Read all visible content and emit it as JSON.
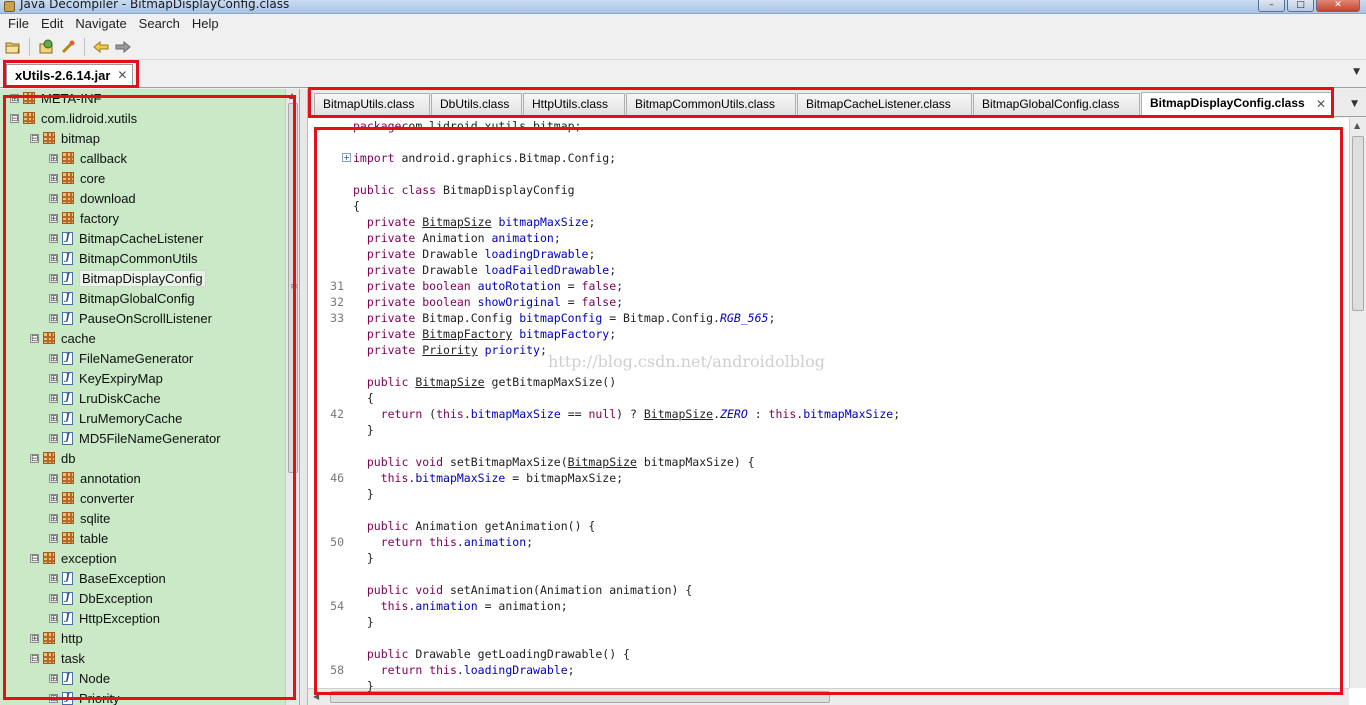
{
  "window": {
    "title": "Java Decompiler - BitmapDisplayConfig.class",
    "controls": [
      "–",
      "□",
      "✕"
    ]
  },
  "menu": [
    "File",
    "Edit",
    "Navigate",
    "Search",
    "Help"
  ],
  "toolbar": {
    "icons": [
      "open-folder-icon",
      "open-type-icon",
      "open-type-hierarchy-icon",
      "back-arrow-icon",
      "forward-arrow-icon"
    ]
  },
  "jar_tab": {
    "label": "xUtils-2.6.14.jar",
    "close": "✕"
  },
  "tree": {
    "expanded": "⊟",
    "collapsed": "⊞",
    "items": [
      {
        "label": "META-INF",
        "type": "package",
        "level": 0,
        "expander": "collapsed"
      },
      {
        "label": "com.lidroid.xutils",
        "type": "package",
        "level": 0,
        "expander": "expanded"
      },
      {
        "label": "bitmap",
        "type": "package",
        "level": 1,
        "expander": "expanded"
      },
      {
        "label": "callback",
        "type": "package",
        "level": 2,
        "expander": "collapsed"
      },
      {
        "label": "core",
        "type": "package",
        "level": 2,
        "expander": "collapsed"
      },
      {
        "label": "download",
        "type": "package",
        "level": 2,
        "expander": "collapsed"
      },
      {
        "label": "factory",
        "type": "package",
        "level": 2,
        "expander": "collapsed"
      },
      {
        "label": "BitmapCacheListener",
        "type": "class",
        "level": 2,
        "expander": "collapsed"
      },
      {
        "label": "BitmapCommonUtils",
        "type": "class",
        "level": 2,
        "expander": "collapsed"
      },
      {
        "label": "BitmapDisplayConfig",
        "type": "class",
        "level": 2,
        "expander": "collapsed",
        "selected": true
      },
      {
        "label": "BitmapGlobalConfig",
        "type": "class",
        "level": 2,
        "expander": "collapsed"
      },
      {
        "label": "PauseOnScrollListener",
        "type": "class",
        "level": 2,
        "expander": "collapsed"
      },
      {
        "label": "cache",
        "type": "package",
        "level": 1,
        "expander": "expanded"
      },
      {
        "label": "FileNameGenerator",
        "type": "class",
        "level": 2,
        "expander": "collapsed"
      },
      {
        "label": "KeyExpiryMap",
        "type": "class",
        "level": 2,
        "expander": "collapsed"
      },
      {
        "label": "LruDiskCache",
        "type": "class",
        "level": 2,
        "expander": "collapsed"
      },
      {
        "label": "LruMemoryCache",
        "type": "class",
        "level": 2,
        "expander": "collapsed"
      },
      {
        "label": "MD5FileNameGenerator",
        "type": "class",
        "level": 2,
        "expander": "collapsed"
      },
      {
        "label": "db",
        "type": "package",
        "level": 1,
        "expander": "expanded"
      },
      {
        "label": "annotation",
        "type": "package",
        "level": 2,
        "expander": "collapsed"
      },
      {
        "label": "converter",
        "type": "package",
        "level": 2,
        "expander": "collapsed"
      },
      {
        "label": "sqlite",
        "type": "package",
        "level": 2,
        "expander": "collapsed"
      },
      {
        "label": "table",
        "type": "package",
        "level": 2,
        "expander": "collapsed"
      },
      {
        "label": "exception",
        "type": "package",
        "level": 1,
        "expander": "expanded"
      },
      {
        "label": "BaseException",
        "type": "class",
        "level": 2,
        "expander": "collapsed"
      },
      {
        "label": "DbException",
        "type": "class",
        "level": 2,
        "expander": "collapsed"
      },
      {
        "label": "HttpException",
        "type": "class",
        "level": 2,
        "expander": "collapsed"
      },
      {
        "label": "http",
        "type": "package",
        "level": 1,
        "expander": "collapsed"
      },
      {
        "label": "task",
        "type": "package",
        "level": 1,
        "expander": "expanded"
      },
      {
        "label": "Node",
        "type": "class",
        "level": 2,
        "expander": "collapsed"
      },
      {
        "label": "Priority",
        "type": "class",
        "level": 2,
        "expander": "collapsed"
      }
    ]
  },
  "class_tabs": [
    {
      "label": "BitmapUtils.class"
    },
    {
      "label": "DbUtils.class"
    },
    {
      "label": "HttpUtils.class"
    },
    {
      "label": "BitmapCommonUtils.class"
    },
    {
      "label": "BitmapCacheListener.class"
    },
    {
      "label": "BitmapGlobalConfig.class"
    },
    {
      "label": "BitmapDisplayConfig.class",
      "active": true,
      "close": "✕"
    }
  ],
  "editor": {
    "watermark": "http://blog.csdn.net/androidolblog",
    "fold_marker": "+",
    "lines": [
      {
        "num": "",
        "segs": [
          [
            "kw",
            "package"
          ],
          [
            "",
            "com.lidroid.xutils.bitmap;"
          ]
        ]
      },
      {
        "num": "",
        "segs": []
      },
      {
        "num": "",
        "fold": true,
        "segs": [
          [
            "kw",
            "import"
          ],
          [
            "",
            " android.graphics.Bitmap.Config;"
          ]
        ]
      },
      {
        "num": "",
        "segs": []
      },
      {
        "num": "",
        "segs": [
          [
            "kw",
            "public class"
          ],
          [
            "",
            " BitmapDisplayConfig"
          ]
        ]
      },
      {
        "num": "",
        "segs": [
          [
            "",
            "{"
          ]
        ]
      },
      {
        "num": "",
        "segs": [
          [
            "",
            "  "
          ],
          [
            "kw",
            "private"
          ],
          [
            "",
            " "
          ],
          [
            "ul",
            "BitmapSize"
          ],
          [
            "",
            " "
          ],
          [
            "fld",
            "bitmapMaxSize"
          ],
          [
            "",
            ";"
          ]
        ]
      },
      {
        "num": "",
        "segs": [
          [
            "",
            "  "
          ],
          [
            "kw",
            "private"
          ],
          [
            "",
            " Animation "
          ],
          [
            "fld",
            "animation"
          ],
          [
            "",
            ";"
          ]
        ]
      },
      {
        "num": "",
        "segs": [
          [
            "",
            "  "
          ],
          [
            "kw",
            "private"
          ],
          [
            "",
            " Drawable "
          ],
          [
            "fld",
            "loadingDrawable"
          ],
          [
            "",
            ";"
          ]
        ]
      },
      {
        "num": "",
        "segs": [
          [
            "",
            "  "
          ],
          [
            "kw",
            "private"
          ],
          [
            "",
            " Drawable "
          ],
          [
            "fld",
            "loadFailedDrawable"
          ],
          [
            "",
            ";"
          ]
        ]
      },
      {
        "num": "31",
        "segs": [
          [
            "",
            "  "
          ],
          [
            "kw",
            "private boolean"
          ],
          [
            "",
            " "
          ],
          [
            "fld",
            "autoRotation"
          ],
          [
            "",
            " = "
          ],
          [
            "kw",
            "false"
          ],
          [
            "",
            ";"
          ]
        ]
      },
      {
        "num": "32",
        "segs": [
          [
            "",
            "  "
          ],
          [
            "kw",
            "private boolean"
          ],
          [
            "",
            " "
          ],
          [
            "fld",
            "showOriginal"
          ],
          [
            "",
            " = "
          ],
          [
            "kw",
            "false"
          ],
          [
            "",
            ";"
          ]
        ]
      },
      {
        "num": "33",
        "segs": [
          [
            "",
            "  "
          ],
          [
            "kw",
            "private"
          ],
          [
            "",
            " Bitmap.Config "
          ],
          [
            "fld",
            "bitmapConfig"
          ],
          [
            "",
            " = Bitmap.Config."
          ],
          [
            "fld italic",
            "RGB_565"
          ],
          [
            "",
            ";"
          ]
        ]
      },
      {
        "num": "",
        "segs": [
          [
            "",
            "  "
          ],
          [
            "kw",
            "private"
          ],
          [
            "",
            " "
          ],
          [
            "ul",
            "BitmapFactory"
          ],
          [
            "",
            " "
          ],
          [
            "fld",
            "bitmapFactory"
          ],
          [
            "",
            ";"
          ]
        ]
      },
      {
        "num": "",
        "segs": [
          [
            "",
            "  "
          ],
          [
            "kw",
            "private"
          ],
          [
            "",
            " "
          ],
          [
            "ul",
            "Priority"
          ],
          [
            "",
            " "
          ],
          [
            "fld",
            "priority"
          ],
          [
            "",
            ";"
          ]
        ]
      },
      {
        "num": "",
        "segs": []
      },
      {
        "num": "",
        "segs": [
          [
            "",
            "  "
          ],
          [
            "kw",
            "public"
          ],
          [
            "",
            " "
          ],
          [
            "ul",
            "BitmapSize"
          ],
          [
            "",
            " getBitmapMaxSize()"
          ]
        ]
      },
      {
        "num": "",
        "segs": [
          [
            "",
            "  {"
          ]
        ]
      },
      {
        "num": "42",
        "segs": [
          [
            "",
            "    "
          ],
          [
            "kw",
            "return"
          ],
          [
            "",
            " ("
          ],
          [
            "kw",
            "this"
          ],
          [
            "",
            "."
          ],
          [
            "fld",
            "bitmapMaxSize"
          ],
          [
            "",
            " == "
          ],
          [
            "kw",
            "null"
          ],
          [
            "",
            ") ? "
          ],
          [
            "ul",
            "BitmapSize"
          ],
          [
            "",
            "."
          ],
          [
            "fld italic",
            "ZERO"
          ],
          [
            "",
            " : "
          ],
          [
            "kw",
            "this"
          ],
          [
            "",
            "."
          ],
          [
            "fld",
            "bitmapMaxSize"
          ],
          [
            "",
            ";"
          ]
        ]
      },
      {
        "num": "",
        "segs": [
          [
            "",
            "  }"
          ]
        ]
      },
      {
        "num": "",
        "segs": []
      },
      {
        "num": "",
        "segs": [
          [
            "",
            "  "
          ],
          [
            "kw",
            "public void"
          ],
          [
            "",
            " setBitmapMaxSize("
          ],
          [
            "ul",
            "BitmapSize"
          ],
          [
            "",
            " bitmapMaxSize) {"
          ]
        ]
      },
      {
        "num": "46",
        "segs": [
          [
            "",
            "    "
          ],
          [
            "kw",
            "this"
          ],
          [
            "",
            "."
          ],
          [
            "fld",
            "bitmapMaxSize"
          ],
          [
            "",
            " = bitmapMaxSize;"
          ]
        ]
      },
      {
        "num": "",
        "segs": [
          [
            "",
            "  }"
          ]
        ]
      },
      {
        "num": "",
        "segs": []
      },
      {
        "num": "",
        "segs": [
          [
            "",
            "  "
          ],
          [
            "kw",
            "public"
          ],
          [
            "",
            " Animation getAnimation() {"
          ]
        ]
      },
      {
        "num": "50",
        "segs": [
          [
            "",
            "    "
          ],
          [
            "kw",
            "return this"
          ],
          [
            "",
            "."
          ],
          [
            "fld",
            "animation"
          ],
          [
            "",
            ";"
          ]
        ]
      },
      {
        "num": "",
        "segs": [
          [
            "",
            "  }"
          ]
        ]
      },
      {
        "num": "",
        "segs": []
      },
      {
        "num": "",
        "segs": [
          [
            "",
            "  "
          ],
          [
            "kw",
            "public void"
          ],
          [
            "",
            " setAnimation(Animation animation) {"
          ]
        ]
      },
      {
        "num": "54",
        "segs": [
          [
            "",
            "    "
          ],
          [
            "kw",
            "this"
          ],
          [
            "",
            "."
          ],
          [
            "fld",
            "animation"
          ],
          [
            "",
            " = animation;"
          ]
        ]
      },
      {
        "num": "",
        "segs": [
          [
            "",
            "  }"
          ]
        ]
      },
      {
        "num": "",
        "segs": []
      },
      {
        "num": "",
        "segs": [
          [
            "",
            "  "
          ],
          [
            "kw",
            "public"
          ],
          [
            "",
            " Drawable getLoadingDrawable() {"
          ]
        ]
      },
      {
        "num": "58",
        "segs": [
          [
            "",
            "    "
          ],
          [
            "kw",
            "return this"
          ],
          [
            "",
            "."
          ],
          [
            "fld",
            "loadingDrawable"
          ],
          [
            "",
            ";"
          ]
        ]
      },
      {
        "num": "",
        "segs": [
          [
            "",
            "  }"
          ]
        ]
      }
    ]
  },
  "annotation_color": "#e3101a",
  "tree_bg_color": "#c9e9c7"
}
